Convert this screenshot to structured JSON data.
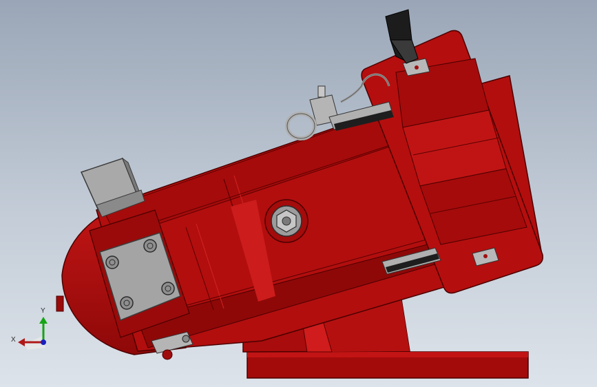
{
  "viewport": {
    "background_top": "#9aa6b7",
    "background_bottom": "#dde3ea"
  },
  "model": {
    "body_color": "#b30d0d",
    "body_dark": "#7a0606",
    "body_light": "#d42020",
    "metal_color": "#9a9a9a"
  },
  "axis_triad": {
    "y_label": "Y",
    "x_label": "X",
    "y_color": "#15a515",
    "x_color": "#b01818",
    "z_color": "#1820c0"
  }
}
